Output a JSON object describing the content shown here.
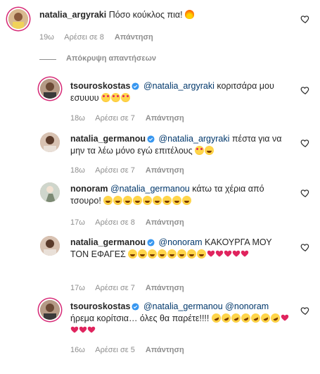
{
  "hide_replies": "Απόκρυψη απαντήσεων",
  "reply_label": "Απάντηση",
  "colors": {
    "mention": "#00376b",
    "meta": "#8e8e8e",
    "heart_emoji": "#e0245e"
  },
  "comments": [
    {
      "username": "natalia_argyraki",
      "text": "Πόσο κούκλος πια!",
      "emojis": [
        "fire"
      ],
      "time": "19ω",
      "likes": "Αρέσει σε 8"
    },
    {
      "username": "tsouroskostas",
      "verified": true,
      "mention": "@natalia_argyraki",
      "text": "κοριτσάρα μου εσυυυυ",
      "emojis": [
        "heart-eyes",
        "heart-eyes",
        "heart-eyes"
      ],
      "time": "18ω",
      "likes": "Αρέσει σε 7"
    },
    {
      "username": "natalia_germanou",
      "verified": true,
      "mention": "@natalia_argyraki",
      "text": "πέστα για να μην τα λέω μόνο εγώ επιτέλους",
      "emojis": [
        "heart-eyes",
        "laugh"
      ],
      "time": "18ω",
      "likes": "Αρέσει σε 7"
    },
    {
      "username": "nonoram",
      "mention": "@natalia_germanou",
      "text": "κάτω τα χέρια από τσουρο!",
      "emojis": [
        "laugh",
        "laugh",
        "laugh",
        "laugh",
        "laugh",
        "laugh",
        "laugh",
        "laugh",
        "laugh"
      ],
      "time": "17ω",
      "likes": "Αρέσει σε 8"
    },
    {
      "username": "natalia_germanou",
      "verified": true,
      "mention": "@nonoram",
      "text": "ΚΑΚΟΥΡΓΑ ΜΟΥ ΤΟΝ ΕΦΑΓΕΣ",
      "emojis": [
        "laugh",
        "laugh",
        "laugh",
        "laugh",
        "laugh",
        "laugh",
        "laugh",
        "laugh",
        "heart",
        "heart",
        "heart",
        "heart",
        "heart"
      ],
      "time": "17ω",
      "likes": "Αρέσει σε 7"
    },
    {
      "username": "tsouroskostas",
      "verified": true,
      "mention": "@natalia_germanou @nonoram",
      "text": "ήρεμα κορίτσια… όλες θα παρέτε!!!!",
      "emojis": [
        "rofl",
        "rofl",
        "rofl",
        "rofl",
        "rofl",
        "rofl",
        "rofl",
        "heart",
        "heart",
        "heart",
        "heart"
      ],
      "time": "16ω",
      "likes": "Αρέσει σε 5"
    }
  ]
}
